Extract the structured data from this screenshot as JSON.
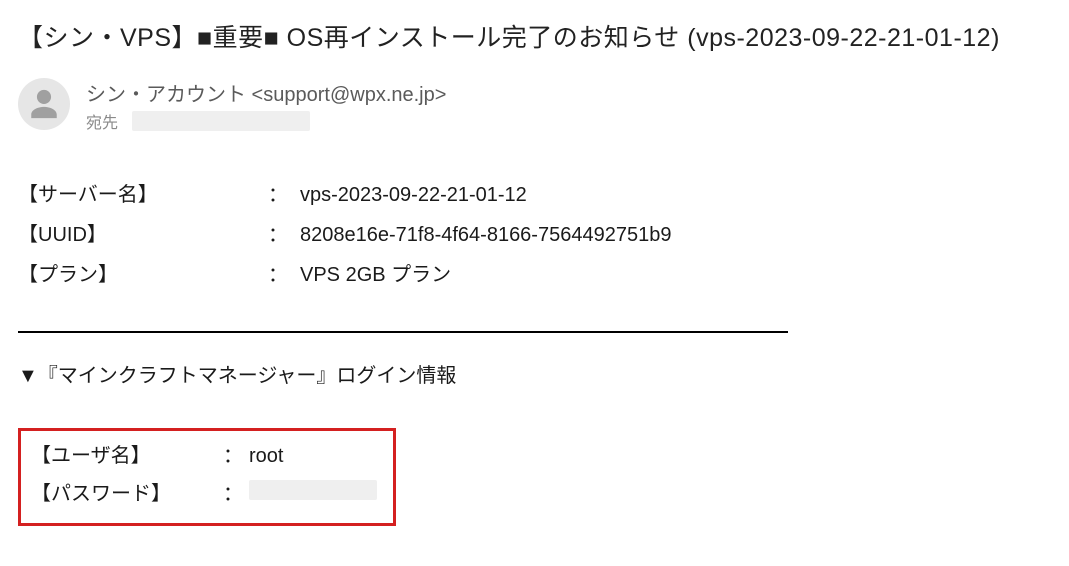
{
  "subject": "【シン・VPS】■重要■  OS再インストール完了のお知らせ (vps-2023-09-22-21-01-12)",
  "sender": {
    "display": "シン・アカウント <support@wpx.ne.jp>",
    "to_label": "宛先"
  },
  "server_info": {
    "rows": [
      {
        "label": "【サーバー名】",
        "value": "vps-2023-09-22-21-01-12"
      },
      {
        "label": "【UUID】",
        "value": "8208e16e-71f8-4f64-8166-7564492751b9"
      },
      {
        "label": "【プラン】",
        "value": "VPS 2GB プラン"
      }
    ]
  },
  "login_section": {
    "title": "▼『マインクラフトマネージャー』ログイン情報",
    "rows": [
      {
        "label": "【ユーザ名】",
        "value": "root"
      },
      {
        "label": "【パスワード】",
        "value": ""
      }
    ]
  },
  "colon": "："
}
